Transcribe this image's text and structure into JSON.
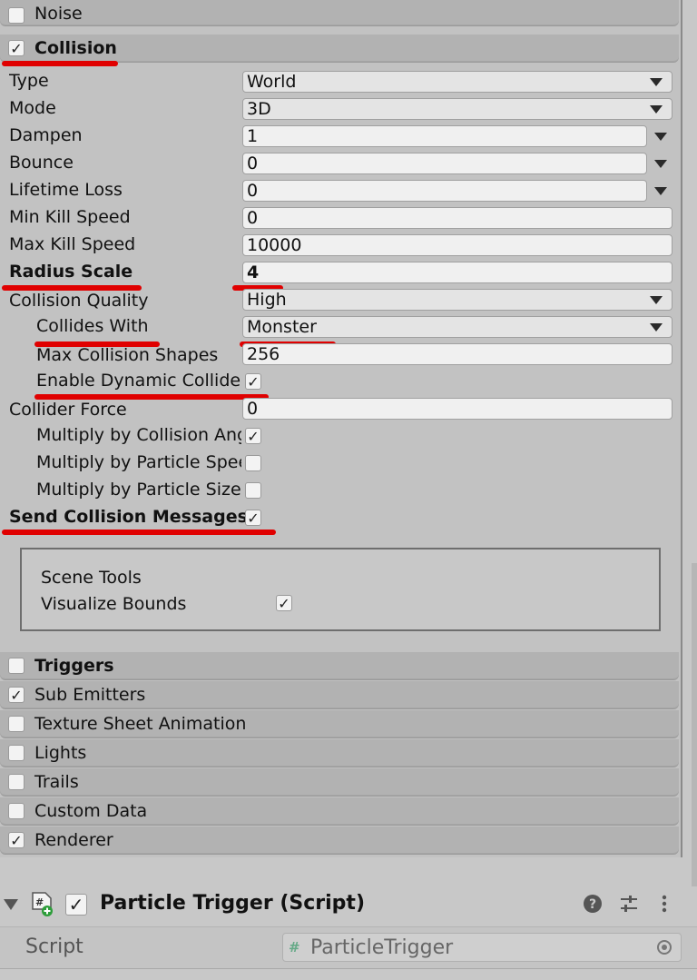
{
  "modules_top": [
    {
      "name": "Noise",
      "checked": false,
      "bold": false
    },
    {
      "name": "Collision",
      "checked": true,
      "bold": true
    }
  ],
  "collision": {
    "type_label": "Type",
    "type_value": "World",
    "mode_label": "Mode",
    "mode_value": "3D",
    "dampen_label": "Dampen",
    "dampen_value": "1",
    "bounce_label": "Bounce",
    "bounce_value": "0",
    "lifetime_loss_label": "Lifetime Loss",
    "lifetime_loss_value": "0",
    "min_kill_label": "Min Kill Speed",
    "min_kill_value": "0",
    "max_kill_label": "Max Kill Speed",
    "max_kill_value": "10000",
    "radius_scale_label": "Radius Scale",
    "radius_scale_value": "4",
    "quality_label": "Collision Quality",
    "quality_value": "High",
    "collides_with_label": "Collides With",
    "collides_with_value": "Monster",
    "max_shapes_label": "Max Collision Shapes",
    "max_shapes_value": "256",
    "dynamic_label": "Enable Dynamic Collider",
    "dynamic_checked": true,
    "collider_force_label": "Collider Force",
    "collider_force_value": "0",
    "mult_angle_label": "Multiply by Collision Angle",
    "mult_angle_checked": true,
    "mult_speed_label": "Multiply by Particle Speed",
    "mult_speed_checked": false,
    "mult_size_label": "Multiply by Particle Size",
    "mult_size_checked": false,
    "send_msgs_label": "Send Collision Messages",
    "send_msgs_checked": true
  },
  "scene_tools": {
    "title": "Scene Tools",
    "visualize_label": "Visualize Bounds",
    "visualize_checked": true
  },
  "modules_bottom": [
    {
      "name": "Triggers",
      "checked": false,
      "bold": true
    },
    {
      "name": "Sub Emitters",
      "checked": true,
      "bold": false
    },
    {
      "name": "Texture Sheet Animation",
      "checked": false,
      "bold": false
    },
    {
      "name": "Lights",
      "checked": false,
      "bold": false
    },
    {
      "name": "Trails",
      "checked": false,
      "bold": false
    },
    {
      "name": "Custom Data",
      "checked": false,
      "bold": false
    },
    {
      "name": "Renderer",
      "checked": true,
      "bold": false
    }
  ],
  "component": {
    "title": "Particle Trigger (Script)",
    "enabled": true,
    "script_label": "Script",
    "script_value": "ParticleTrigger",
    "script_hash": "#"
  },
  "icons": {
    "fold": "triangle-down-icon",
    "script": "cs-script-add-icon",
    "help": "help-icon",
    "presets": "sliders-icon",
    "menu": "kebab-menu-icon",
    "object_picker": "object-picker-icon"
  },
  "colors": {
    "highlight_red": "#e00000",
    "panel_bg": "#c2c2c2",
    "header_bg": "#b2b2b2"
  }
}
